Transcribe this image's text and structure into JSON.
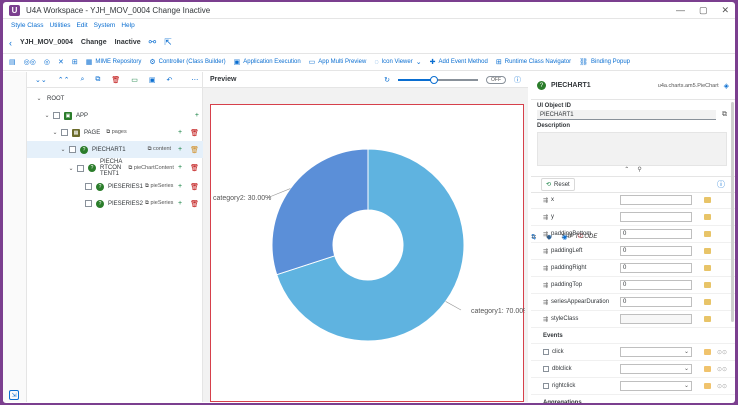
{
  "window": {
    "title": "U4A Workspace - YJH_MOV_0004 Change Inactive",
    "logo": "U",
    "icons": [
      "minimize-icon",
      "maximize-icon",
      "close-icon"
    ]
  },
  "menu": {
    "items": [
      "Style Class",
      "Utilities",
      "Edit",
      "System",
      "Help"
    ],
    "tcode": "SAP T-CODE"
  },
  "objectbar": {
    "app_id": "YJH_MOV_0004",
    "mode": "Change",
    "state": "Inactive"
  },
  "toolbar": {
    "items": [
      "MIME Repository",
      "Controller (Class Builder)",
      "Application Execution",
      "App Multi Preview",
      "Icon Viewer",
      "Add Event Method",
      "Runtime Class Navigator",
      "Binding Popup"
    ]
  },
  "tree": {
    "nodes": [
      {
        "label": "ROOT",
        "aggr": ""
      },
      {
        "label": "APP",
        "aggr": ""
      },
      {
        "label": "PAGE",
        "aggr": "pages"
      },
      {
        "label": "PIECHART1",
        "aggr": "content"
      },
      {
        "label_lines": [
          "PIECHA",
          "RTCON",
          "TENT1"
        ],
        "aggr": "pieChartContent"
      },
      {
        "label": "PIESERIES1",
        "aggr": "pieSeries"
      },
      {
        "label": "PIESERIES2",
        "aggr": "pieSeries"
      }
    ]
  },
  "preview": {
    "title": "Preview",
    "zoom_fraction": 0.45,
    "toggle_label": "OFF"
  },
  "chart_data": {
    "type": "pie",
    "style": "donut",
    "labels": [
      "category1",
      "category2"
    ],
    "values": [
      70.0,
      30.0
    ],
    "data_labels": [
      "category1: 70.00%",
      "category2: 30.00%"
    ],
    "colors": [
      "#5fb3e0",
      "#5b8fd8"
    ]
  },
  "rightpanel": {
    "title": "PIECHART1",
    "class_name": "u4a.charts.am5.PieChart",
    "ui_object_id_label": "UI Object ID",
    "ui_object_id_value": "PIECHART1",
    "description_label": "Description",
    "reset_label": "Reset",
    "properties": [
      {
        "name": "x",
        "value": ""
      },
      {
        "name": "y",
        "value": ""
      },
      {
        "name": "paddingBottom",
        "value": "0"
      },
      {
        "name": "paddingLeft",
        "value": "0"
      },
      {
        "name": "paddingRight",
        "value": "0"
      },
      {
        "name": "paddingTop",
        "value": "0"
      },
      {
        "name": "seriesAppearDuration",
        "value": "0"
      },
      {
        "name": "styleClass",
        "value": ""
      }
    ],
    "events_label": "Events",
    "events": [
      {
        "name": "click"
      },
      {
        "name": "dblclick"
      },
      {
        "name": "rightclick"
      }
    ],
    "next_section": "Aggregations"
  }
}
